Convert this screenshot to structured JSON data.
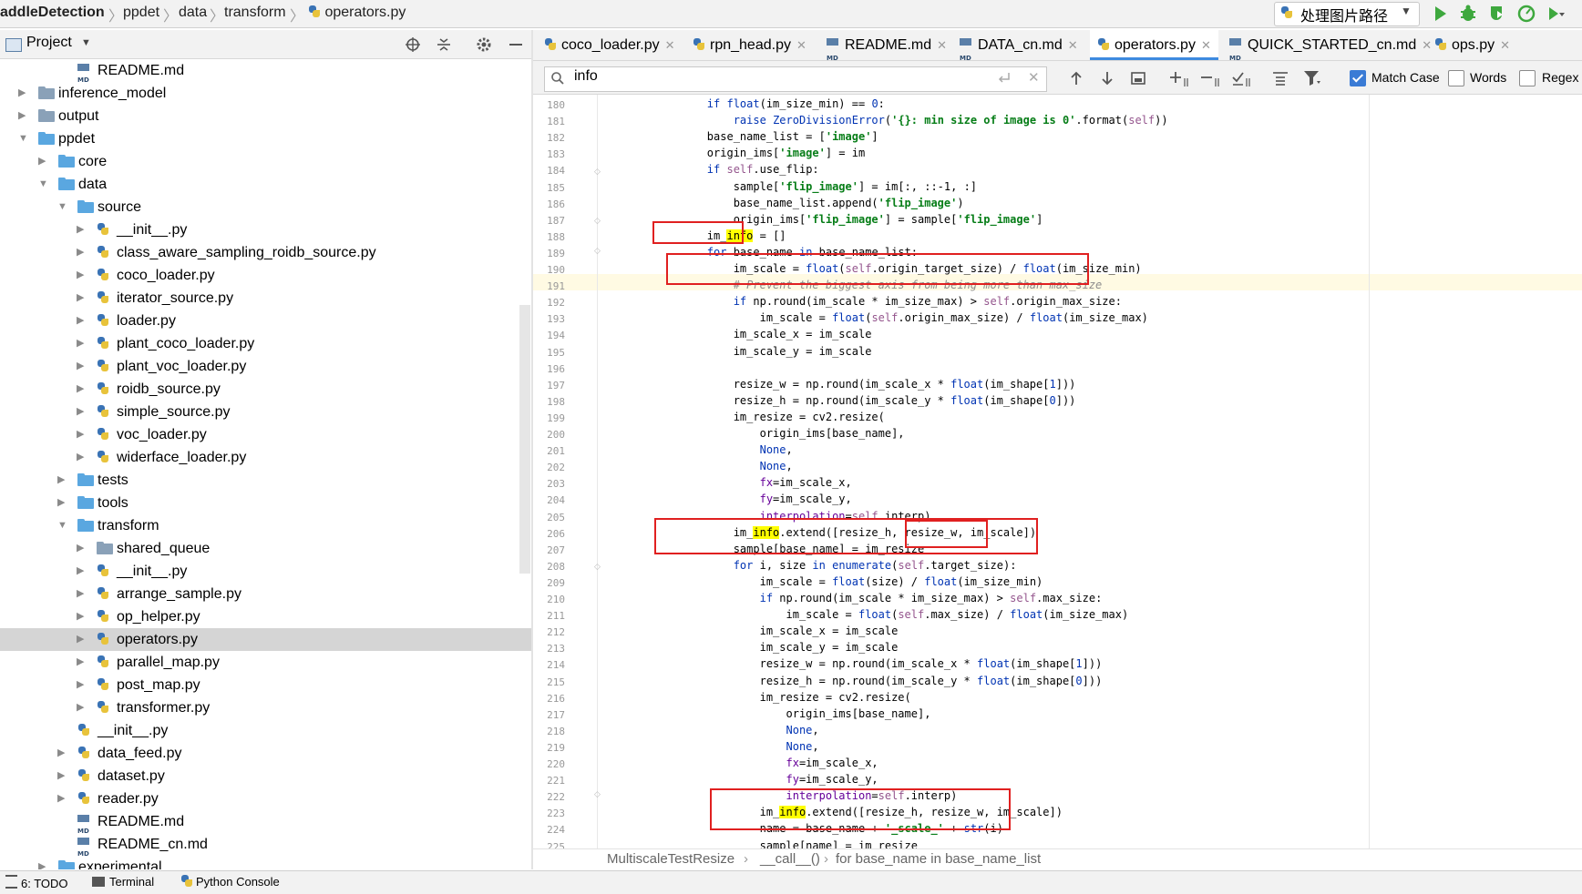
{
  "navbar": {
    "crumbs": [
      "addleDetection",
      "ppdet",
      "data",
      "transform",
      "operators.py"
    ],
    "run_config": "处理图片路径"
  },
  "project_panel": {
    "title": "Project",
    "tree": [
      {
        "label": "README.md",
        "kind": "md",
        "depth": 3,
        "arrow": ""
      },
      {
        "label": "inference_model",
        "kind": "folder",
        "depth": 1,
        "arrow": "right"
      },
      {
        "label": "output",
        "kind": "folder",
        "depth": 1,
        "arrow": "right"
      },
      {
        "label": "ppdet",
        "kind": "pkg",
        "depth": 1,
        "arrow": "down"
      },
      {
        "label": "core",
        "kind": "pkg",
        "depth": 2,
        "arrow": "right"
      },
      {
        "label": "data",
        "kind": "pkg",
        "depth": 2,
        "arrow": "down"
      },
      {
        "label": "source",
        "kind": "pkg",
        "depth": 3,
        "arrow": "down"
      },
      {
        "label": "__init__.py",
        "kind": "py",
        "depth": 4,
        "arrow": "right"
      },
      {
        "label": "class_aware_sampling_roidb_source.py",
        "kind": "py",
        "depth": 4,
        "arrow": "right"
      },
      {
        "label": "coco_loader.py",
        "kind": "py",
        "depth": 4,
        "arrow": "right"
      },
      {
        "label": "iterator_source.py",
        "kind": "py",
        "depth": 4,
        "arrow": "right"
      },
      {
        "label": "loader.py",
        "kind": "py",
        "depth": 4,
        "arrow": "right"
      },
      {
        "label": "plant_coco_loader.py",
        "kind": "py",
        "depth": 4,
        "arrow": "right"
      },
      {
        "label": "plant_voc_loader.py",
        "kind": "py",
        "depth": 4,
        "arrow": "right"
      },
      {
        "label": "roidb_source.py",
        "kind": "py",
        "depth": 4,
        "arrow": "right"
      },
      {
        "label": "simple_source.py",
        "kind": "py",
        "depth": 4,
        "arrow": "right"
      },
      {
        "label": "voc_loader.py",
        "kind": "py",
        "depth": 4,
        "arrow": "right"
      },
      {
        "label": "widerface_loader.py",
        "kind": "py",
        "depth": 4,
        "arrow": "right"
      },
      {
        "label": "tests",
        "kind": "pkg",
        "depth": 3,
        "arrow": "right"
      },
      {
        "label": "tools",
        "kind": "pkg",
        "depth": 3,
        "arrow": "right"
      },
      {
        "label": "transform",
        "kind": "pkg",
        "depth": 3,
        "arrow": "down"
      },
      {
        "label": "shared_queue",
        "kind": "folder",
        "depth": 4,
        "arrow": "right"
      },
      {
        "label": "__init__.py",
        "kind": "py",
        "depth": 4,
        "arrow": "right"
      },
      {
        "label": "arrange_sample.py",
        "kind": "py",
        "depth": 4,
        "arrow": "right"
      },
      {
        "label": "op_helper.py",
        "kind": "py",
        "depth": 4,
        "arrow": "right"
      },
      {
        "label": "operators.py",
        "kind": "py",
        "depth": 4,
        "arrow": "right",
        "selected": true
      },
      {
        "label": "parallel_map.py",
        "kind": "py",
        "depth": 4,
        "arrow": "right"
      },
      {
        "label": "post_map.py",
        "kind": "py",
        "depth": 4,
        "arrow": "right"
      },
      {
        "label": "transformer.py",
        "kind": "py",
        "depth": 4,
        "arrow": "right"
      },
      {
        "label": "__init__.py",
        "kind": "py",
        "depth": 3,
        "arrow": ""
      },
      {
        "label": "data_feed.py",
        "kind": "py",
        "depth": 3,
        "arrow": "right"
      },
      {
        "label": "dataset.py",
        "kind": "py",
        "depth": 3,
        "arrow": "right"
      },
      {
        "label": "reader.py",
        "kind": "py",
        "depth": 3,
        "arrow": "right"
      },
      {
        "label": "README.md",
        "kind": "md",
        "depth": 3,
        "arrow": ""
      },
      {
        "label": "README_cn.md",
        "kind": "md",
        "depth": 3,
        "arrow": ""
      },
      {
        "label": "experimental",
        "kind": "pkg",
        "depth": 2,
        "arrow": "right"
      }
    ]
  },
  "tabs": [
    {
      "label": "coco_loader.py",
      "kind": "py"
    },
    {
      "label": "rpn_head.py",
      "kind": "py"
    },
    {
      "label": "README.md",
      "kind": "md"
    },
    {
      "label": "DATA_cn.md",
      "kind": "md"
    },
    {
      "label": "operators.py",
      "kind": "py",
      "active": true
    },
    {
      "label": "QUICK_STARTED_cn.md",
      "kind": "md"
    },
    {
      "label": "ops.py",
      "kind": "py"
    }
  ],
  "search": {
    "query": "info",
    "match_case_label": "Match Case",
    "match_case": true,
    "words_label": "Words",
    "words": false,
    "regex_label": "Regex",
    "regex": false
  },
  "code": {
    "lines": [
      {
        "n": "180",
        "html": "        <span class='kw'>if</span> <span class='bi'>float</span>(im_size_min) == <span class='bi'>0</span>:"
      },
      {
        "n": "181",
        "html": "            <span class='kw'>raise</span> <span class='bi'>ZeroDivisionError</span>(<span class='st'>'{}: min size of image is 0'</span>.format(<span class='sf'>self</span>))"
      },
      {
        "n": "182",
        "html": "        base_name_list = [<span class='st'>'image'</span>]"
      },
      {
        "n": "183",
        "html": "        origin_ims[<span class='st'>'image'</span>] = im"
      },
      {
        "n": "184",
        "html": "        <span class='kw'>if</span> <span class='sf'>self</span>.use_flip:"
      },
      {
        "n": "185",
        "html": "            sample[<span class='st'>'flip_image'</span>] = im[:, ::-1, :]"
      },
      {
        "n": "186",
        "html": "            base_name_list.append(<span class='st'>'flip_image'</span>)"
      },
      {
        "n": "187",
        "html": "            origin_ims[<span class='st'>'flip_image'</span>] = sample[<span class='st'>'flip_image'</span>]"
      },
      {
        "n": "188",
        "html": "        im_<span class='hl'>info</span> = []"
      },
      {
        "n": "189",
        "html": "        <span class='kw'>for</span> base_name <span class='kw'>in</span> base_name_list:"
      },
      {
        "n": "190",
        "html": "            im_scale = <span class='bi'>float</span>(<span class='sf'>self</span>.origin_target_size) / <span class='bi'>float</span>(im_size_min)"
      },
      {
        "n": "191",
        "html": "            <span class='cm'># Prevent the biggest axis from being more than max_size</span>"
      },
      {
        "n": "192",
        "html": "            <span class='kw'>if</span> np.round(im_scale * im_size_max) > <span class='sf'>self</span>.origin_max_size:"
      },
      {
        "n": "193",
        "html": "                im_scale = <span class='bi'>float</span>(<span class='sf'>self</span>.origin_max_size) / <span class='bi'>float</span>(im_size_max)"
      },
      {
        "n": "194",
        "html": "            im_scale_x = im_scale"
      },
      {
        "n": "195",
        "html": "            im_scale_y = im_scale"
      },
      {
        "n": "196",
        "html": ""
      },
      {
        "n": "197",
        "html": "            resize_w = np.round(im_scale_x * <span class='bi'>float</span>(im_shape[<span class='bi'>1</span>]))"
      },
      {
        "n": "198",
        "html": "            resize_h = np.round(im_scale_y * <span class='bi'>float</span>(im_shape[<span class='bi'>0</span>]))"
      },
      {
        "n": "199",
        "html": "            im_resize = cv2.resize("
      },
      {
        "n": "200",
        "html": "                origin_ims[base_name],"
      },
      {
        "n": "201",
        "html": "                <span class='kw'>None</span>,"
      },
      {
        "n": "202",
        "html": "                <span class='kw'>None</span>,"
      },
      {
        "n": "203",
        "html": "                <span class='pa'>fx</span>=im_scale_x,"
      },
      {
        "n": "204",
        "html": "                <span class='pa'>fy</span>=im_scale_y,"
      },
      {
        "n": "205",
        "html": "                <span class='pa'>interpolation</span>=<span class='sf'>self</span>.interp)"
      },
      {
        "n": "206",
        "html": "            im_<span class='hl'>info</span>.extend([resize_h, resize_w, im_scale])"
      },
      {
        "n": "207",
        "html": "            sample[base_name] = im_resize"
      },
      {
        "n": "208",
        "html": "            <span class='kw'>for</span> i, size <span class='kw'>in</span> <span class='bi'>enumerate</span>(<span class='sf'>self</span>.target_size):"
      },
      {
        "n": "209",
        "html": "                im_scale = <span class='bi'>float</span>(size) / <span class='bi'>float</span>(im_size_min)"
      },
      {
        "n": "210",
        "html": "                <span class='kw'>if</span> np.round(im_scale * im_size_max) > <span class='sf'>self</span>.max_size:"
      },
      {
        "n": "211",
        "html": "                    im_scale = <span class='bi'>float</span>(<span class='sf'>self</span>.max_size) / <span class='bi'>float</span>(im_size_max)"
      },
      {
        "n": "212",
        "html": "                im_scale_x = im_scale"
      },
      {
        "n": "213",
        "html": "                im_scale_y = im_scale"
      },
      {
        "n": "214",
        "html": "                resize_w = np.round(im_scale_x * <span class='bi'>float</span>(im_shape[<span class='bi'>1</span>]))"
      },
      {
        "n": "215",
        "html": "                resize_h = np.round(im_scale_y * <span class='bi'>float</span>(im_shape[<span class='bi'>0</span>]))"
      },
      {
        "n": "216",
        "html": "                im_resize = cv2.resize("
      },
      {
        "n": "217",
        "html": "                    origin_ims[base_name],"
      },
      {
        "n": "218",
        "html": "                    <span class='kw'>None</span>,"
      },
      {
        "n": "219",
        "html": "                    <span class='kw'>None</span>,"
      },
      {
        "n": "220",
        "html": "                    <span class='pa'>fx</span>=im_scale_x,"
      },
      {
        "n": "221",
        "html": "                    <span class='pa'>fy</span>=im_scale_y,"
      },
      {
        "n": "222",
        "html": "                    <span class='pa'>interpolation</span>=<span class='sf'>self</span>.interp)"
      },
      {
        "n": "223",
        "html": "                im_<span class='hl'>info</span>.extend([resize_h, resize_w, im_scale])"
      },
      {
        "n": "224",
        "html": "                name = base_name + <span class='st'>'_scale_'</span> + <span class='bi'>str</span>(i)"
      },
      {
        "n": "225",
        "html": "                sample[name] = im_resize"
      }
    ]
  },
  "footer_crumbs": [
    "MultiscaleTestResize",
    "__call__()",
    "for base_name in base_name_list"
  ],
  "bottom_bar": {
    "todo": "6: TODO",
    "terminal": "Terminal",
    "python_console": "Python Console"
  },
  "colors": {
    "accent": "#3d8adf",
    "highlight": "#ffff00",
    "annotation_box": "#e02020"
  }
}
